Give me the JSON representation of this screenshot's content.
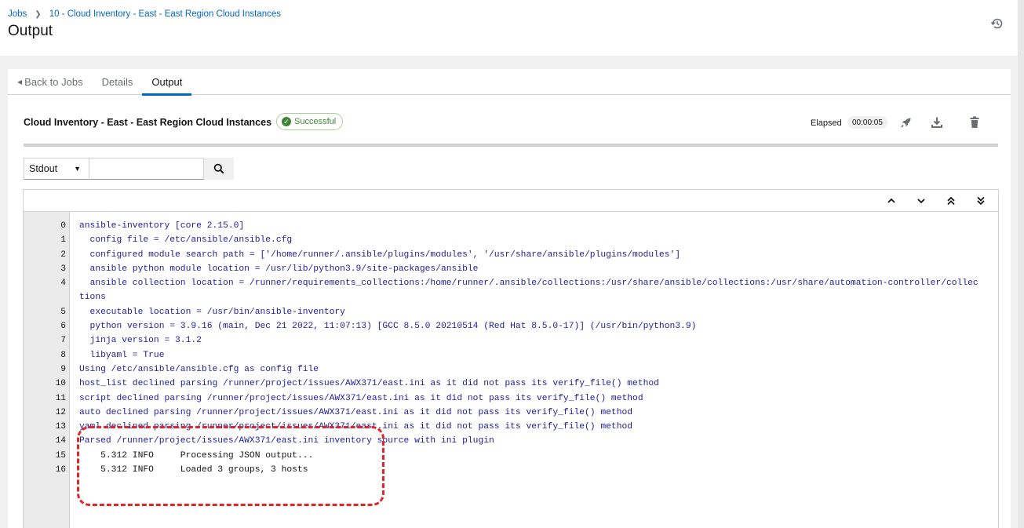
{
  "breadcrumb": {
    "items": [
      "Jobs",
      "10 - Cloud Inventory - East - East Region Cloud Instances"
    ]
  },
  "page": {
    "title": "Output"
  },
  "tabs": [
    {
      "label": "Back to Jobs"
    },
    {
      "label": "Details"
    },
    {
      "label": "Output"
    }
  ],
  "job": {
    "title": "Cloud Inventory - East - East Region Cloud Instances",
    "status": "Successful",
    "elapsed_label": "Elapsed",
    "elapsed_value": "00:00:05"
  },
  "filter": {
    "stream": "Stdout",
    "search_value": ""
  },
  "colors": {
    "accent": "#0066cc",
    "success": "#3e8635",
    "log_text": "#1d1d9a",
    "highlight": "#e0262b"
  },
  "icons": [
    "history-icon",
    "relaunch-rocket-icon",
    "download-icon",
    "delete-icon",
    "search-icon",
    "scroll-top-icon",
    "page-up-icon",
    "page-down-icon",
    "scroll-bottom-icon",
    "check-circle-icon"
  ],
  "log": {
    "lines": [
      {
        "n": "0",
        "text": "ansible-inventory [core 2.15.0]"
      },
      {
        "n": "1",
        "text": "  config file = /etc/ansible/ansible.cfg"
      },
      {
        "n": "2",
        "text": "  configured module search path = ['/home/runner/.ansible/plugins/modules', '/usr/share/ansible/plugins/modules']"
      },
      {
        "n": "3",
        "text": "  ansible python module location = /usr/lib/python3.9/site-packages/ansible"
      },
      {
        "n": "4",
        "text": "  ansible collection location = /runner/requirements_collections:/home/runner/.ansible/collections:/usr/share/ansible/collections:/usr/share/automation-controller/collections"
      },
      {
        "n": "5",
        "text": "  executable location = /usr/bin/ansible-inventory"
      },
      {
        "n": "6",
        "text": "  python version = 3.9.16 (main, Dec 21 2022, 11:07:13) [GCC 8.5.0 20210514 (Red Hat 8.5.0-17)] (/usr/bin/python3.9)"
      },
      {
        "n": "7",
        "text": "  jinja version = 3.1.2"
      },
      {
        "n": "8",
        "text": "  libyaml = True"
      },
      {
        "n": "9",
        "text": "Using /etc/ansible/ansible.cfg as config file"
      },
      {
        "n": "10",
        "text": "host_list declined parsing /runner/project/issues/AWX371/east.ini as it did not pass its verify_file() method"
      },
      {
        "n": "11",
        "text": "script declined parsing /runner/project/issues/AWX371/east.ini as it did not pass its verify_file() method"
      },
      {
        "n": "12",
        "text": "auto declined parsing /runner/project/issues/AWX371/east.ini as it did not pass its verify_file() method"
      },
      {
        "n": "13",
        "text": "yaml declined parsing /runner/project/issues/AWX371/east.ini as it did not pass its verify_file() method"
      },
      {
        "n": "14",
        "text": "Parsed /runner/project/issues/AWX371/east.ini inventory source with ini plugin"
      },
      {
        "n": "15",
        "text": "    5.312 INFO     Processing JSON output..."
      },
      {
        "n": "16",
        "text": "    5.312 INFO     Loaded 3 groups, 3 hosts"
      }
    ]
  }
}
